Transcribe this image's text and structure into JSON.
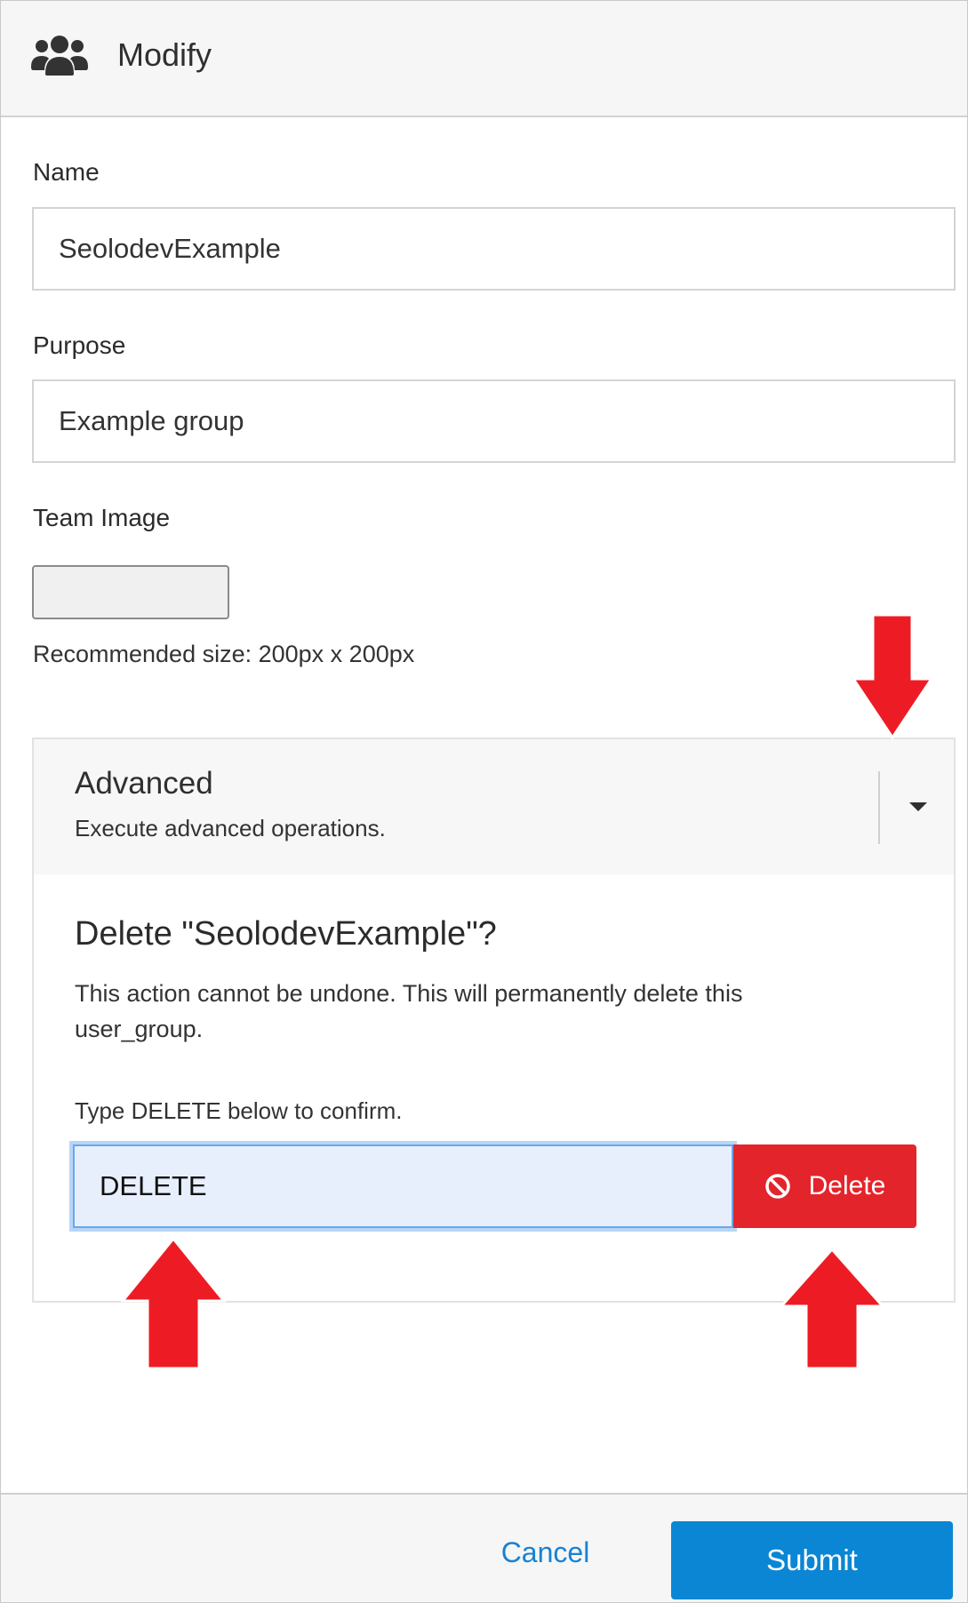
{
  "header": {
    "title": "Modify",
    "icon": "users-icon"
  },
  "form": {
    "name": {
      "label": "Name",
      "value": "SeolodevExample"
    },
    "purpose": {
      "label": "Purpose",
      "value": "Example group"
    },
    "team_image": {
      "label": "Team Image",
      "hint": "Recommended size: 200px x 200px"
    }
  },
  "advanced": {
    "title": "Advanced",
    "subtitle": "Execute advanced operations.",
    "delete": {
      "title": "Delete \"SeolodevExample\"?",
      "description": "This action cannot be undone. This will permanently delete this user_group.",
      "prompt": "Type DELETE below to confirm.",
      "confirm_value": "DELETE",
      "button_label": "Delete",
      "button_icon": "ban-icon"
    }
  },
  "footer": {
    "cancel_label": "Cancel",
    "submit_label": "Submit"
  },
  "colors": {
    "danger": "#e4242b",
    "primary": "#0a86d4",
    "link": "#1682d4",
    "annotation_arrow": "#ed1c24"
  }
}
